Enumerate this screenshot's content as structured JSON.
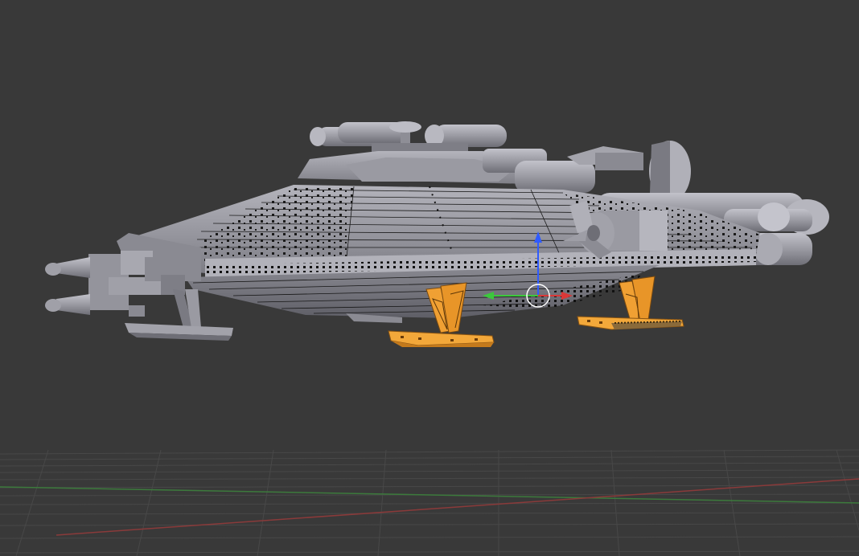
{
  "viewport": {
    "background": "#393939",
    "shading": "solid",
    "grid": true
  },
  "scene": {
    "object": "spaceship-hull",
    "selected": [
      "landing-strut-front",
      "landing-strut-rear"
    ],
    "selection_color": "#f5a623"
  },
  "gizmo": {
    "type": "translate",
    "axes": [
      "x",
      "y",
      "z"
    ],
    "axis_colors": {
      "x": "#d93838",
      "y": "#3cc83c",
      "z": "#2f5bff"
    }
  },
  "colors": {
    "hull_light": "#a8a8b0",
    "hull_mid": "#8c8c94",
    "hull_dark": "#6a6a72",
    "wire": "#141414",
    "grid_line": "#4a4a4a",
    "x_axis_line": "#8a3a3a",
    "y_axis_line": "#3c7a3c"
  }
}
